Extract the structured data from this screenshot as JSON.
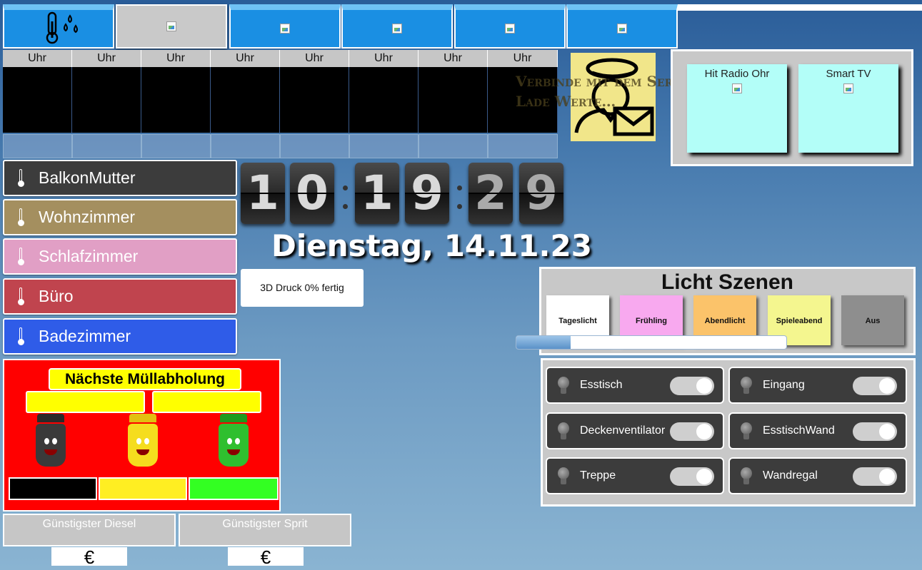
{
  "nav": {
    "tabs": [
      {
        "name": "temperature-humidity-icon"
      },
      {
        "name": "broken-image"
      },
      {
        "name": "broken-image"
      },
      {
        "name": "broken-image"
      },
      {
        "name": "broken-image"
      },
      {
        "name": "broken-image"
      }
    ]
  },
  "clocks": {
    "labels": [
      "Uhr",
      "Uhr",
      "Uhr",
      "Uhr",
      "Uhr",
      "Uhr",
      "Uhr",
      "Uhr"
    ]
  },
  "server": {
    "line1": "Verbinde mit dem Server…",
    "line2": "Lade Werte…"
  },
  "media": {
    "items": [
      {
        "label": "Hit Radio Ohr"
      },
      {
        "label": "Smart TV"
      }
    ]
  },
  "rooms": [
    {
      "label": "BalkonMutter",
      "color": "#3c3c3c"
    },
    {
      "label": "Wohnzimmer",
      "color": "#a48f5f"
    },
    {
      "label": "Schlafzimmer",
      "color": "#e19fc5"
    },
    {
      "label": "Büro",
      "color": "#c0444e"
    },
    {
      "label": "Badezimmer",
      "color": "#2f5ce8"
    }
  ],
  "flipclock": {
    "digits": [
      "1",
      "0",
      "1",
      "9",
      "2",
      "9"
    ]
  },
  "date": "Dienstag, 14.11.23",
  "printer": {
    "status": "3D Druck 0% fertig"
  },
  "scenes": {
    "title": "Licht Szenen",
    "items": [
      {
        "label": "Tageslicht",
        "color": "#ffffff"
      },
      {
        "label": "Frühling",
        "color": "#f8a9ef"
      },
      {
        "label": "Abendlicht",
        "color": "#fbc36a"
      },
      {
        "label": "Spieleabend",
        "color": "#f4f68f"
      },
      {
        "label": "Aus",
        "color": "#8e8e8e"
      }
    ],
    "progress": 0.2
  },
  "lights": [
    {
      "label": "Esstisch"
    },
    {
      "label": "Eingang"
    },
    {
      "label": "Deckenventilator"
    },
    {
      "label": "EsstischWand"
    },
    {
      "label": "Treppe"
    },
    {
      "label": "Wandregal"
    }
  ],
  "waste": {
    "title": "Nächste Müllabholung",
    "cans": [
      {
        "color": "#3a3a3a",
        "name": "black-bin"
      },
      {
        "color": "#f5dd1e",
        "name": "yellow-bin"
      },
      {
        "color": "#2fbf2f",
        "name": "green-bin"
      }
    ],
    "bars": [
      "#000000",
      "#ffee22",
      "#33ff22"
    ]
  },
  "fuel": {
    "diesel": {
      "label": "Günstigster Diesel",
      "currency": "€"
    },
    "sprit": {
      "label": "Günstigster Sprit",
      "currency": "€"
    }
  }
}
